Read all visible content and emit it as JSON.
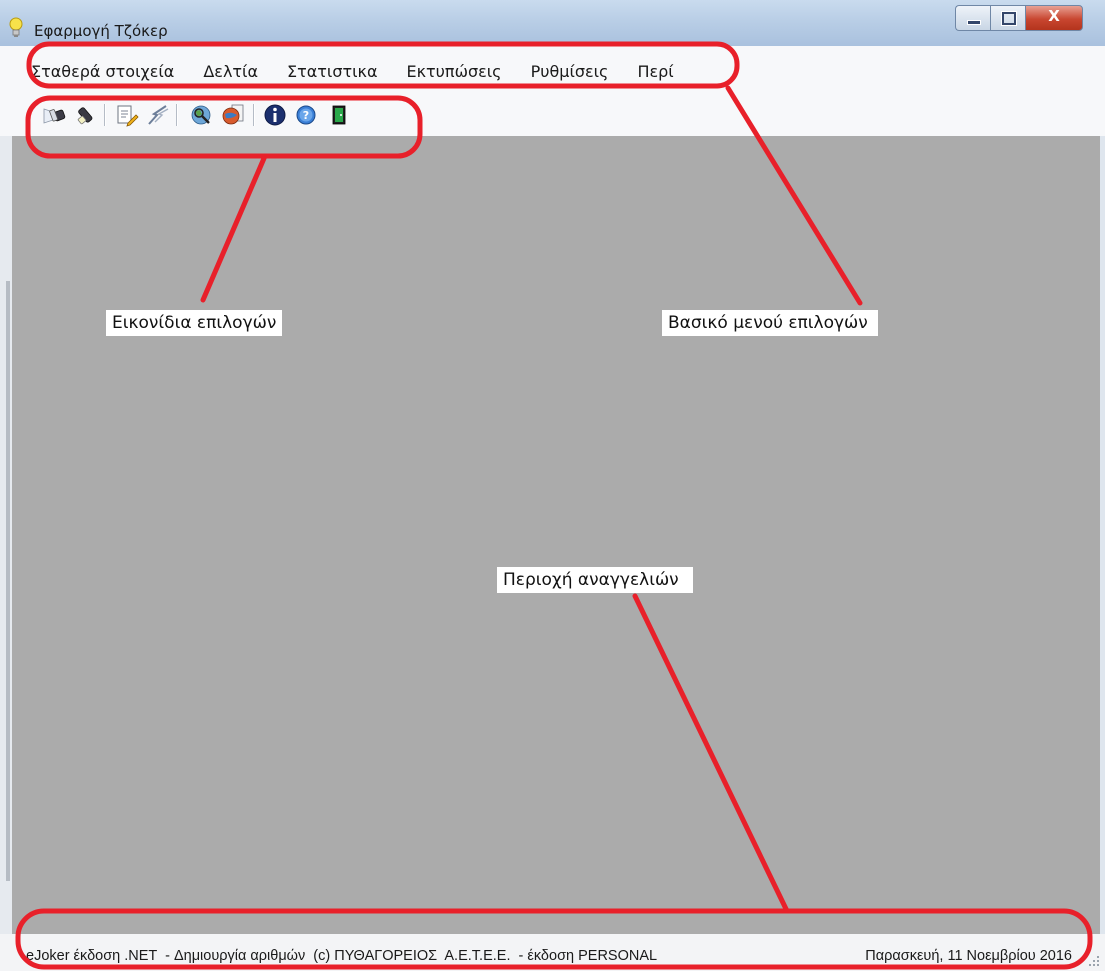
{
  "window": {
    "title": "Εφαρμογή Τζόκερ",
    "title_icon": "lightbulb-icon",
    "controls": {
      "minimize_icon": "minimize-icon",
      "maximize_icon": "maximize-icon",
      "close_icon": "close-icon",
      "close_glyph": "X"
    }
  },
  "menu": {
    "items": [
      {
        "label": "Σταθερά στοιχεία"
      },
      {
        "label": "Δελτία"
      },
      {
        "label": "Στατιστικα"
      },
      {
        "label": "Εκτυπώσεις"
      },
      {
        "label": "Ρυθμίσεις"
      },
      {
        "label": "Περί"
      }
    ]
  },
  "toolbar": {
    "buttons": [
      {
        "icon": "flashlight-beam-icon"
      },
      {
        "icon": "flashlight-icon"
      },
      {
        "icon": "edit-document-icon"
      },
      {
        "icon": "lightning-icon"
      },
      {
        "icon": "search-globe-icon"
      },
      {
        "icon": "globe-document-icon"
      },
      {
        "icon": "info-icon"
      },
      {
        "icon": "help-icon"
      },
      {
        "icon": "exit-door-icon"
      }
    ]
  },
  "annotations": {
    "toolbar_label": "Εικονίδια επιλογών",
    "menu_label": "Βασικό μενού επιλογών",
    "status_label": "Περιοχή αναγγελιών"
  },
  "status": {
    "left_text": "eJoker έκδοση .NET  - Δημιουργία αριθμών  (c) ΠΥΘΑΓΟΡΕΙΟΣ  Α.Ε.Τ.Ε.Ε.  - έκδοση PERSONAL",
    "date_text": "Παρασκευή, 11 Νοεμβρίου 2016"
  },
  "colors": {
    "client_area": "#ababab",
    "annotation_red": "#e8202a",
    "titlebar": "#b9cee6"
  }
}
